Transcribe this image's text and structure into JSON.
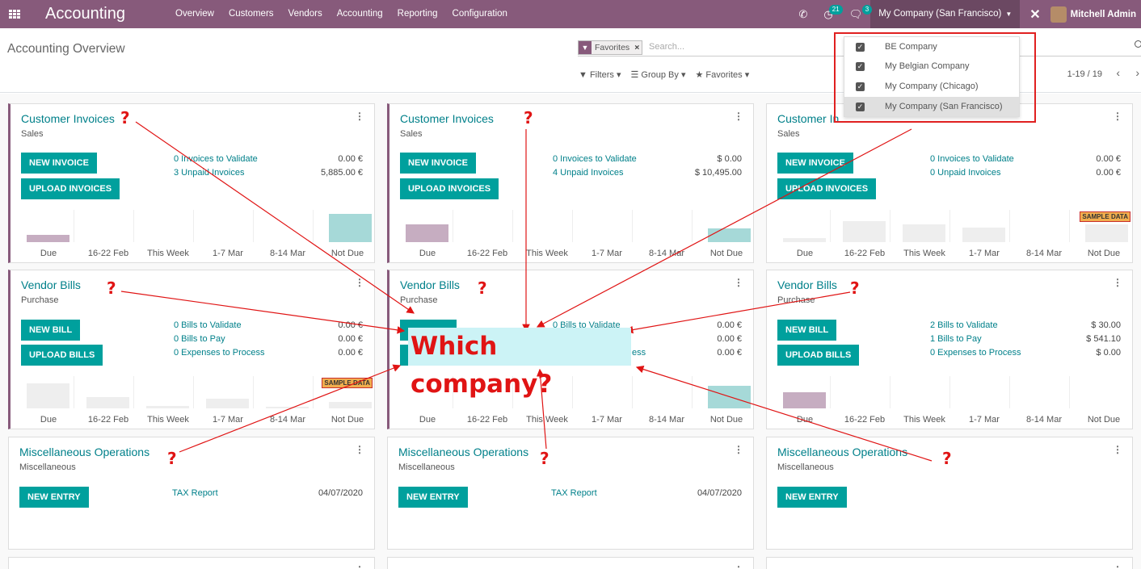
{
  "topbar": {
    "app_title": "Accounting",
    "menu": [
      "Overview",
      "Customers",
      "Vendors",
      "Accounting",
      "Reporting",
      "Configuration"
    ],
    "activity_count": "21",
    "messages_count": "3",
    "current_company": "My Company (San Francisco)",
    "user_name": "Mitchell Admin",
    "close_glyph": "✕"
  },
  "control_panel": {
    "title": "Accounting Overview",
    "facet_label": "Favorites",
    "search_placeholder": "Search...",
    "filters_label": "Filters",
    "groupby_label": "Group By",
    "favorites_label": "Favorites",
    "pager": "1-19 / 19"
  },
  "company_dropdown": {
    "items": [
      {
        "label": "BE Company",
        "checked": true
      },
      {
        "label": "My Belgian Company",
        "checked": true
      },
      {
        "label": "My Company (Chicago)",
        "checked": true
      },
      {
        "label": "My Company (San Francisco)",
        "checked": true,
        "active": true
      }
    ]
  },
  "chart_labels": [
    "Due",
    "16-22 Feb",
    "This Week",
    "1-7 Mar",
    "8-14 Mar",
    "Not Due"
  ],
  "sample_data_label": "SAMPLE DATA",
  "cards": {
    "col1": {
      "invoices": {
        "title": "Customer Invoices",
        "subtitle": "Sales",
        "btn1": "NEW INVOICE",
        "btn2": "UPLOAD INVOICES",
        "stats": [
          {
            "label": "0 Invoices to Validate",
            "value": "0.00 €"
          },
          {
            "label": "3 Unpaid Invoices",
            "value": "5,885.00 €"
          }
        ]
      },
      "bills": {
        "title": "Vendor Bills",
        "subtitle": "Purchase",
        "btn1": "NEW BILL",
        "btn2": "UPLOAD BILLS",
        "stats": [
          {
            "label": "0 Bills to Validate",
            "value": "0.00 €"
          },
          {
            "label": "0 Bills to Pay",
            "value": "0.00 €"
          },
          {
            "label": "0 Expenses to Process",
            "value": "0.00 €"
          }
        ]
      },
      "misc": {
        "title": "Miscellaneous Operations",
        "subtitle": "Miscellaneous",
        "btn1": "NEW ENTRY",
        "link": "TAX Report",
        "date": "04/07/2020"
      }
    },
    "col2": {
      "invoices": {
        "title": "Customer Invoices",
        "subtitle": "Sales",
        "btn1": "NEW INVOICE",
        "btn2": "UPLOAD INVOICES",
        "stats": [
          {
            "label": "0 Invoices to Validate",
            "value": "$ 0.00"
          },
          {
            "label": "4 Unpaid Invoices",
            "value": "$ 10,495.00"
          }
        ]
      },
      "bills": {
        "title": "Vendor Bills",
        "subtitle": "Purchase",
        "stats": [
          {
            "label": "0 Bills to Validate",
            "value": "0.00 €"
          },
          {
            "label": "",
            "value": "0.00 €"
          },
          {
            "label": "ess",
            "value": "0.00 €"
          }
        ]
      },
      "misc": {
        "title": "Miscellaneous Operations",
        "subtitle": "Miscellaneous",
        "btn1": "NEW ENTRY",
        "link": "TAX Report",
        "date": "04/07/2020"
      }
    },
    "col3": {
      "invoices": {
        "title": "Customer In",
        "subtitle": "Sales",
        "btn1": "NEW INVOICE",
        "btn2": "UPLOAD INVOICES",
        "stats": [
          {
            "label": "0 Invoices to Validate",
            "value": "0.00 €"
          },
          {
            "label": "0 Unpaid Invoices",
            "value": "0.00 €"
          }
        ]
      },
      "bills": {
        "title": "Vendor Bills",
        "subtitle": "Purchase",
        "btn1": "NEW BILL",
        "btn2": "UPLOAD BILLS",
        "stats": [
          {
            "label": "2 Bills to Validate",
            "value": "$ 30.00"
          },
          {
            "label": "1 Bills to Pay",
            "value": "$ 541.10"
          },
          {
            "label": "0 Expenses to Process",
            "value": "$ 0.00"
          }
        ]
      },
      "misc": {
        "title": "Miscellaneous Operations",
        "subtitle": "Miscellaneous",
        "btn1": "NEW ENTRY"
      }
    }
  },
  "annotation": {
    "callout": "Which company?",
    "qmark": "?",
    "color": "#e01414"
  },
  "colors": {
    "navbar": "#875a7b",
    "accent_teal": "#00a09d",
    "link_teal": "#00808a"
  }
}
